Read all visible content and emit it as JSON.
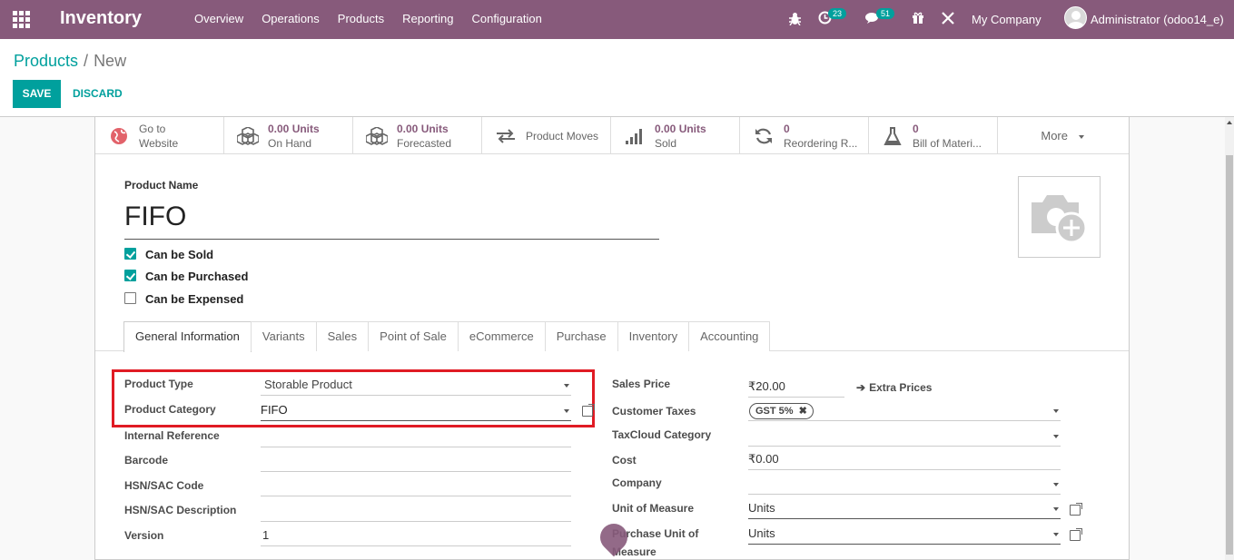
{
  "topbar": {
    "app_title": "Inventory",
    "menu": [
      "Overview",
      "Operations",
      "Products",
      "Reporting",
      "Configuration"
    ],
    "activity_count": "23",
    "messages_count": "51",
    "company": "My Company",
    "user": "Administrator (odoo14_e)"
  },
  "breadcrumb": {
    "parent": "Products",
    "separator": "/",
    "current": "New"
  },
  "buttons": {
    "save": "SAVE",
    "discard": "DISCARD"
  },
  "smart_buttons": [
    {
      "icon": "globe-icon",
      "line1": "Go to",
      "line2": "Website"
    },
    {
      "icon": "cubes-icon",
      "line1": "0.00 Units",
      "line2": "On Hand"
    },
    {
      "icon": "cubes-icon",
      "line1": "0.00 Units",
      "line2": "Forecasted"
    },
    {
      "icon": "exchange-icon",
      "line1": "Product Moves",
      "line2": ""
    },
    {
      "icon": "signal-icon",
      "line1": "0.00 Units",
      "line2": "Sold"
    },
    {
      "icon": "refresh-icon",
      "line1": "0",
      "line2": "Reordering R..."
    },
    {
      "icon": "flask-icon",
      "line1": "0",
      "line2": "Bill of Materi..."
    }
  ],
  "more_label": "More",
  "product": {
    "name_label": "Product Name",
    "name": "FIFO",
    "can_be_sold": "Can be Sold",
    "can_be_purchased": "Can be Purchased",
    "can_be_expensed": "Can be Expensed"
  },
  "tabs": [
    "General Information",
    "Variants",
    "Sales",
    "Point of Sale",
    "eCommerce",
    "Purchase",
    "Inventory",
    "Accounting"
  ],
  "left_fields": {
    "product_type_label": "Product Type",
    "product_type": "Storable Product",
    "category_label": "Product Category",
    "category": "FIFO",
    "internal_ref_label": "Internal Reference",
    "barcode_label": "Barcode",
    "hsn_code_label": "HSN/SAC Code",
    "hsn_desc_label": "HSN/SAC Description",
    "version_label": "Version",
    "version": "1"
  },
  "right_fields": {
    "sales_price_label": "Sales Price",
    "sales_price": "₹20.00",
    "extra_prices": "Extra Prices",
    "customer_taxes_label": "Customer Taxes",
    "tax_tag": "GST 5%",
    "taxcloud_label": "TaxCloud Category",
    "cost_label": "Cost",
    "cost": "₹0.00",
    "company_label": "Company",
    "uom_label": "Unit of Measure",
    "uom": "Units",
    "purchase_uom_label_1": "Purchase Unit of",
    "purchase_uom_label_2": "Measure",
    "purchase_uom": "Units"
  },
  "colors": {
    "brand": "#875a7b",
    "accent": "#00a09d",
    "highlight": "#e01b24"
  }
}
